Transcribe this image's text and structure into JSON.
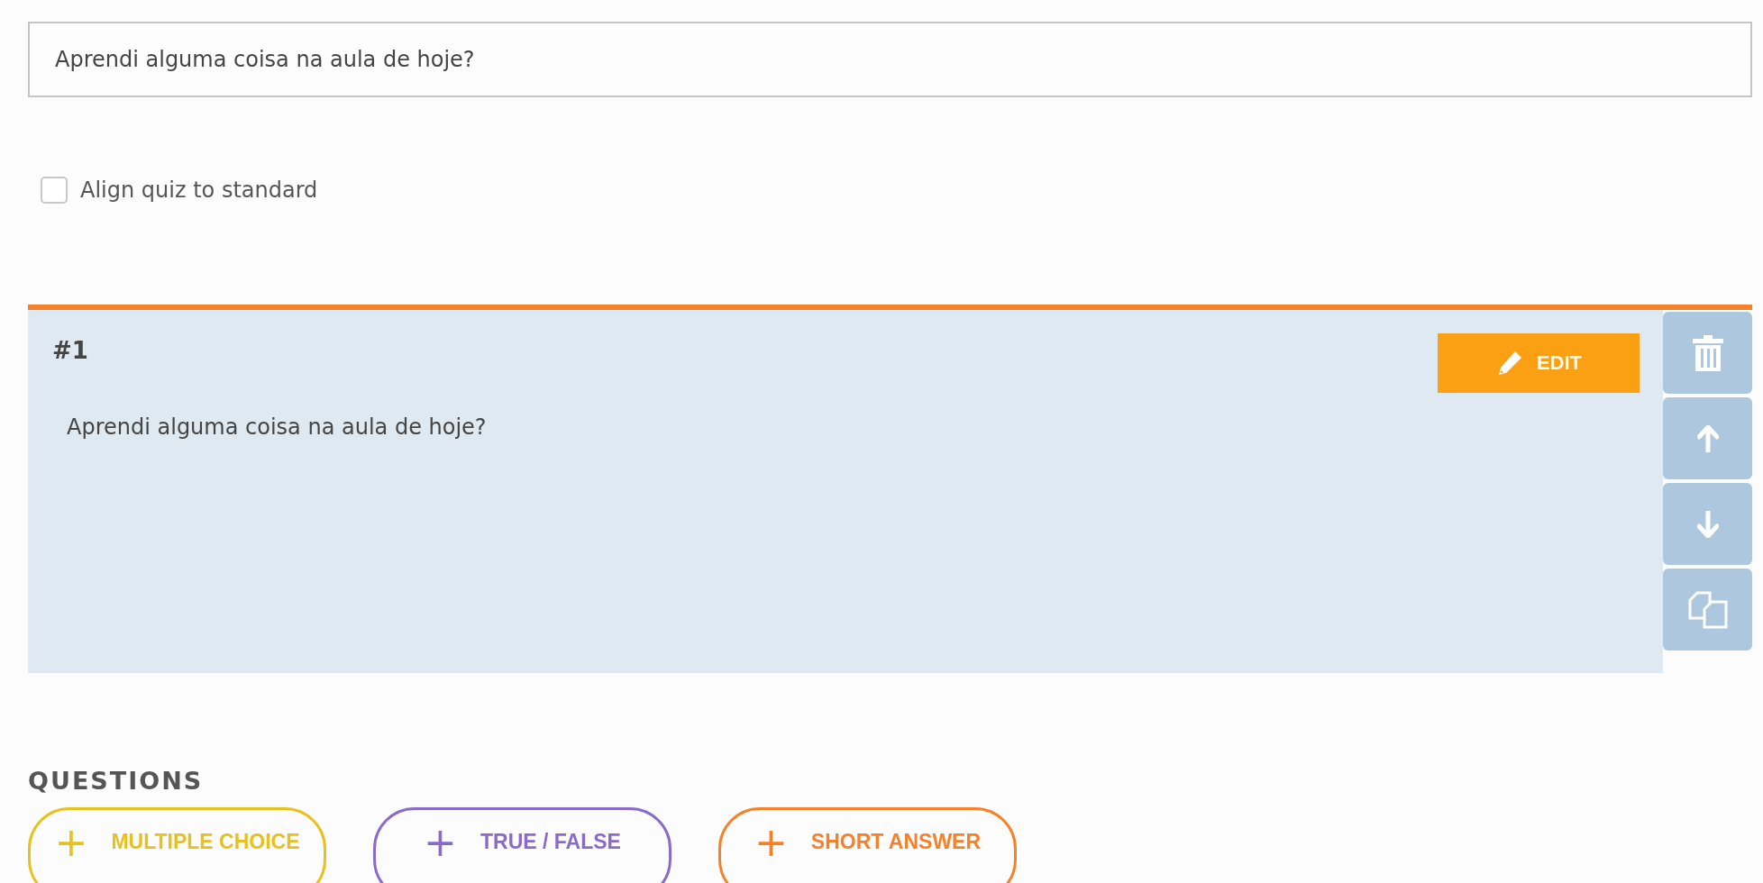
{
  "title_field": {
    "value": "Aprendi alguma coisa na aula de hoje?"
  },
  "align_checkbox": {
    "label": "Align quiz to standard",
    "checked": false
  },
  "question_card": {
    "number": "#1",
    "edit_label": "EDIT",
    "text": "Aprendi alguma coisa na aula de hoje?",
    "side_actions": [
      {
        "kind": "delete"
      },
      {
        "kind": "up"
      },
      {
        "kind": "down"
      },
      {
        "kind": "duplicate"
      }
    ]
  },
  "questions_heading": "QUESTIONS",
  "add_buttons": [
    {
      "icon": "+",
      "label": "MULTIPLE CHOICE",
      "color": "#e6c11f"
    },
    {
      "icon": "+",
      "label": "TRUE / FALSE",
      "color": "#8a6bcc"
    },
    {
      "icon": "+",
      "label": "SHORT ANSWER",
      "color": "#f5822a"
    }
  ]
}
